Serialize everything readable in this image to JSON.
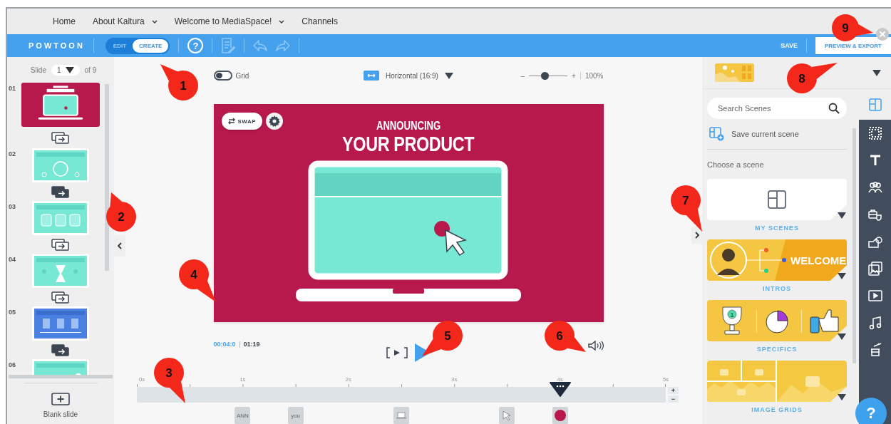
{
  "top_nav": [
    {
      "label": "Home",
      "dropdown": false
    },
    {
      "label": "About Kaltura",
      "dropdown": true
    },
    {
      "label": "Welcome to MediaSpace!",
      "dropdown": true
    },
    {
      "label": "Channels",
      "dropdown": false
    }
  ],
  "toolbar": {
    "logo": "POWTOON",
    "modes": [
      {
        "label": "EDIT",
        "selected": false
      },
      {
        "label": "CREATE",
        "selected": true
      }
    ],
    "help": "?",
    "notes_disabled": true,
    "undo_disabled": true,
    "redo_disabled": true,
    "save": "SAVE",
    "preview_export": "PREVIEW & EXPORT"
  },
  "slides_panel": {
    "label": "Slide",
    "current": "1",
    "total": "of 9",
    "slides": [
      {
        "number": "01",
        "kind": "announce",
        "selected": true,
        "transition_applied": false
      },
      {
        "number": "02",
        "kind": "clock",
        "selected": false,
        "transition_applied": true
      },
      {
        "number": "03",
        "kind": "timer",
        "selected": false,
        "transition_applied": false
      },
      {
        "number": "04",
        "kind": "hourglass",
        "selected": false,
        "transition_applied": false
      },
      {
        "number": "05",
        "kind": "features",
        "selected": false,
        "transition_applied": true
      },
      {
        "number": "06",
        "kind": "landscape",
        "selected": false
      }
    ],
    "blank_slide": "Blank slide"
  },
  "stage": {
    "grid": {
      "label": "Grid",
      "on": false
    },
    "orientation": "Horizontal (16:9)",
    "zoom": {
      "minus": "–",
      "plus": "+",
      "level": 0.4,
      "reading": "100%"
    },
    "slide": {
      "swap": "SWAP",
      "heading_small": "ANNOUNCING",
      "heading_large": "YOUR PRODUCT"
    },
    "current_time": "00:04:0",
    "duration": "01:19"
  },
  "timeline": {
    "ticks": [
      "0s",
      "1s",
      "2s",
      "3s",
      "4s",
      "5s"
    ],
    "playhead": {
      "level": 0.8
    },
    "zoom_in": "+",
    "zoom_out": "−",
    "items": [
      {
        "kind": "text",
        "label": "ANN"
      },
      {
        "kind": "text",
        "label": "you"
      },
      {
        "kind": "laptop"
      },
      {
        "kind": "cursor"
      },
      {
        "kind": "dot"
      }
    ]
  },
  "scenes_panel": {
    "search": {
      "placeholder": "Search Scenes"
    },
    "save_scene": "Save current scene",
    "heading": "Choose a scene",
    "categories": [
      {
        "kind": "my_scenes",
        "label": "MY SCENES"
      },
      {
        "kind": "intros",
        "label": "INTROS",
        "banner": "WELCOME"
      },
      {
        "kind": "specifics",
        "label": "SPECIFICS",
        "badge": "1"
      },
      {
        "kind": "image_grids",
        "label": "IMAGE GRIDS"
      }
    ]
  },
  "tool_rail": [
    {
      "kind": "scenes",
      "selected": true
    },
    {
      "kind": "backgrounds",
      "selected": false
    },
    {
      "kind": "text",
      "selected": false
    },
    {
      "kind": "characters",
      "selected": false
    },
    {
      "kind": "props",
      "selected": false
    },
    {
      "kind": "shapes",
      "selected": false
    },
    {
      "kind": "images",
      "selected": false
    },
    {
      "kind": "video",
      "selected": false
    },
    {
      "kind": "music",
      "selected": false
    },
    {
      "kind": "effects",
      "selected": false
    }
  ],
  "help_button": "?",
  "callouts": [
    "1",
    "2",
    "3",
    "4",
    "5",
    "6",
    "7",
    "8",
    "9"
  ]
}
